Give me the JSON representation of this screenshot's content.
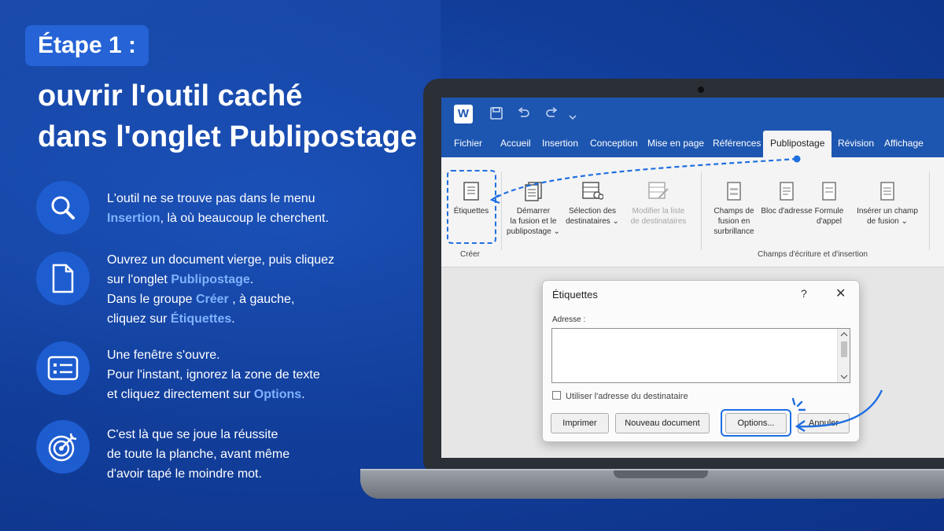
{
  "header": {
    "step_badge": "Étape 1 :",
    "headline_line1": "ouvrir l'outil caché",
    "headline_line2": "dans l'onglet Publipostage"
  },
  "steps": [
    {
      "icon": "search-icon",
      "line1": "L'outil ne se trouve pas dans le menu",
      "line2_hl": "Insertion",
      "line2_rest": ", là où beaucoup le cherchent."
    },
    {
      "icon": "document-icon",
      "line1": "Ouvrez un document vierge, puis cliquez",
      "line2_pre": "sur l'onglet ",
      "line2_hl": "Publipostage",
      "line2_post": ".",
      "line3_pre": "Dans le groupe ",
      "line3_hl": "Créer",
      "line3_post": " , à gauche,",
      "line4_pre": "cliquez sur ",
      "line4_hl": "Étiquettes",
      "line4_post": "."
    },
    {
      "icon": "form-window-icon",
      "line1": "Une fenêtre s'ouvre.",
      "line2": "Pour l'instant, ignorez la zone de texte",
      "line3_pre": "et cliquez directement sur ",
      "line3_hl": "Options",
      "line3_post": "."
    },
    {
      "icon": "target-icon",
      "line1": "C'est là que se joue la réussite",
      "line2": "de toute la planche, avant même",
      "line3": "d'avoir tapé le moindre mot."
    }
  ],
  "word": {
    "logo": "W",
    "tabs": [
      "Fichier",
      "Accueil",
      "Insertion",
      "Conception",
      "Mise en page",
      "Références",
      "Publipostage",
      "Révision",
      "Affichage"
    ],
    "active_tab": "Publipostage",
    "ribbon": {
      "etiquettes": "Étiquettes",
      "demarrer_l1": "Démarrer",
      "demarrer_l2": "la fusion et le",
      "demarrer_l3": "publipostage",
      "selection_l1": "Sélection des",
      "selection_l2": "destinataires",
      "modifier_l1": "Modifier la liste",
      "modifier_l2": "de destinataires",
      "champs_l1": "Champs de",
      "champs_l2": "fusion en",
      "champs_l3": "surbrillance",
      "bloc": "Bloc d'adresse",
      "formule_l1": "Formule",
      "formule_l2": "d'appel",
      "inserer_l1": "Insérer un champ",
      "inserer_l2": "de fusion",
      "group_creer": "Créer",
      "group_champs": "Champs d'écriture et d'insertion"
    },
    "dialog": {
      "title": "Étiquettes",
      "help": "?",
      "close": "✕",
      "address_label": "Adresse :",
      "checkbox_label": "Utiliser l'adresse du destinataire",
      "btn_imprimer": "Imprimer",
      "btn_nouveau": "Nouveau document",
      "btn_options": "Options...",
      "btn_annuler": "Annuler"
    }
  },
  "colors": {
    "background": "#123f9c",
    "accent": "#2563d6",
    "highlight_text": "#7fb2ff",
    "word_blue": "#1d56b0"
  }
}
